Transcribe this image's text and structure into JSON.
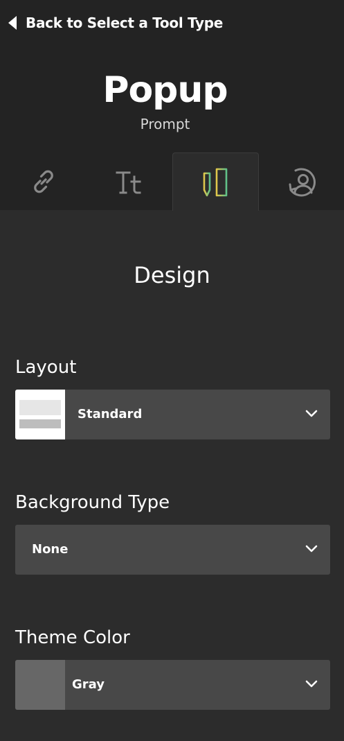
{
  "header": {
    "back_label": "Back to Select a Tool Type",
    "title": "Popup",
    "subtitle": "Prompt"
  },
  "tabs": [
    {
      "icon": "link-icon",
      "active": false
    },
    {
      "icon": "text-icon",
      "active": false
    },
    {
      "icon": "design-icon",
      "active": true
    },
    {
      "icon": "audience-icon",
      "active": false
    }
  ],
  "design": {
    "heading": "Design",
    "layout": {
      "label": "Layout",
      "value": "Standard"
    },
    "background_type": {
      "label": "Background Type",
      "value": "None"
    },
    "theme_color": {
      "label": "Theme Color",
      "value": "Gray",
      "swatch_color": "#676767"
    }
  },
  "colors": {
    "header_bg": "#232323",
    "panel_bg": "#2c2c2c",
    "select_bg": "#484848",
    "icon_gray": "#8a8a8a",
    "accent_yellow": "#e3c74a",
    "accent_green": "#5fc28a"
  }
}
